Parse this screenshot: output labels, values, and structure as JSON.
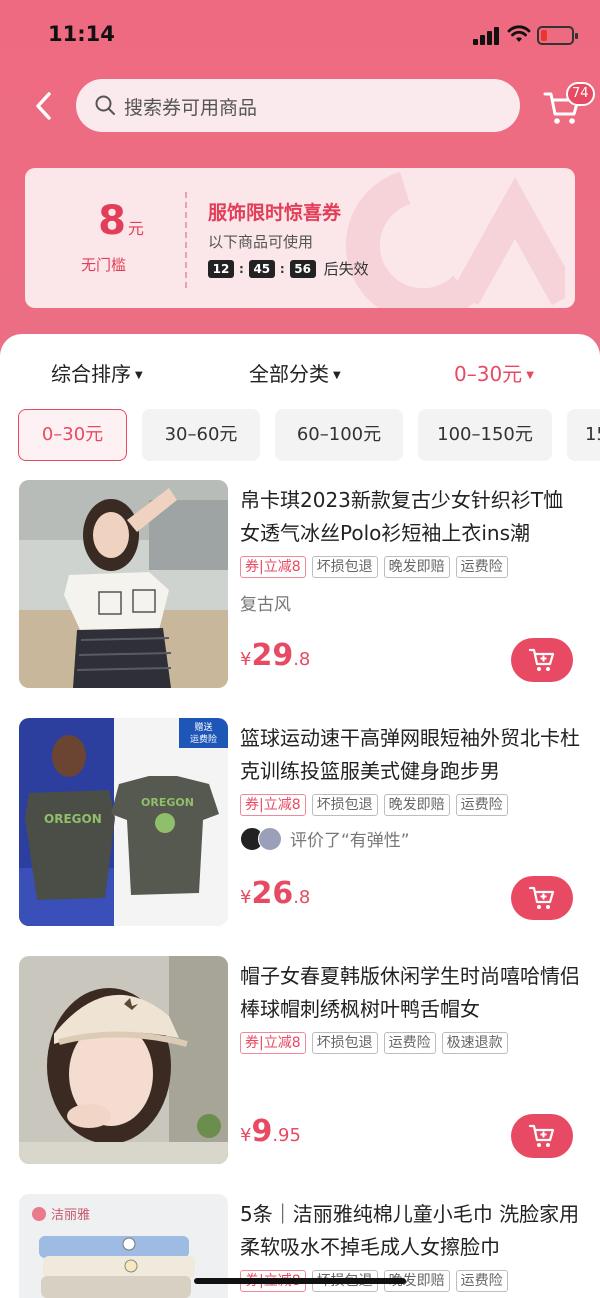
{
  "status": {
    "time": "11:14"
  },
  "search": {
    "placeholder": "搜索券可用商品"
  },
  "cart": {
    "badge": "74"
  },
  "coupon": {
    "amount": "8",
    "unit": "元",
    "threshold": "无门槛",
    "title": "服饰限时惊喜券",
    "subtitle": "以下商品可使用",
    "countdown": [
      "12",
      "45",
      "56"
    ],
    "countdown_suffix": "后失效"
  },
  "sort_bar": {
    "items": [
      {
        "label": "综合排序",
        "active": false
      },
      {
        "label": "全部分类",
        "active": false
      },
      {
        "label": "0–30元",
        "active": true
      }
    ]
  },
  "price_chips": [
    "0–30元",
    "30–60元",
    "60–100元",
    "100–150元",
    "15"
  ],
  "products": [
    {
      "title": "帛卡琪2023新款复古少女针织衫T恤女透气冰丝Polo衫短袖上衣ins潮",
      "tags": [
        "券|立减8",
        "坏损包退",
        "晚发即赔",
        "运费险"
      ],
      "note": "复古风",
      "price_currency": "¥",
      "price_int": "29",
      "price_dec": ".8"
    },
    {
      "title": "篮球运动速干高弹网眼短袖外贸北卡杜克训练投篮服美式健身跑步男",
      "tags": [
        "券|立减8",
        "坏损包退",
        "晚发即赔",
        "运费险"
      ],
      "note": "评价了“有弹性”",
      "image_badge": "赠送\n运费险",
      "shirt_text": "OREGON",
      "price_currency": "¥",
      "price_int": "26",
      "price_dec": ".8"
    },
    {
      "title": "帽子女春夏韩版休闲学生时尚嘻哈情侣棒球帽刺绣枫树叶鸭舌帽女",
      "tags": [
        "券|立减8",
        "坏损包退",
        "运费险",
        "极速退款"
      ],
      "note": "",
      "price_currency": "¥",
      "price_int": "9",
      "price_dec": ".95"
    },
    {
      "title": "5条｜洁丽雅纯棉儿童小毛巾 洗脸家用柔软吸水不掉毛成人女擦脸巾",
      "tags": [
        "券|立减8",
        "坏损包退",
        "晚发即赔",
        "运费险"
      ],
      "brand": "洁丽雅",
      "note": "",
      "price_currency": "",
      "price_int": "",
      "price_dec": ""
    }
  ],
  "colors": {
    "accent": "#e84a63",
    "header": "#ec6c82",
    "coupon_bg": "#fbe7ea"
  }
}
